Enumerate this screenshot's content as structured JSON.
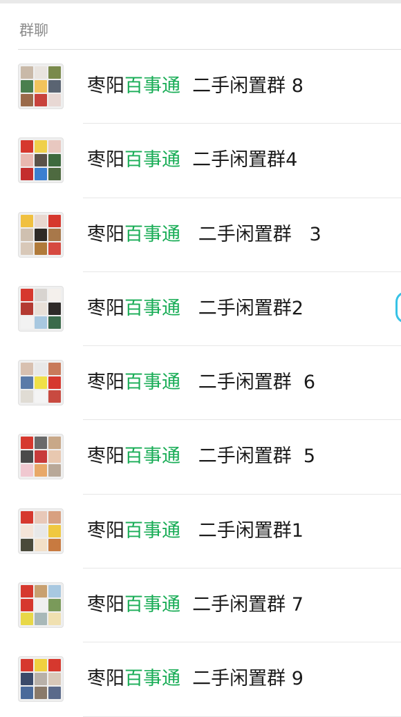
{
  "header": {
    "title": "群聊"
  },
  "palette": {
    "accent": "#1aad57",
    "text": "#1a1a1a",
    "header_text": "#8c8c8c",
    "float_button": "#36c2e6"
  },
  "groups": [
    {
      "prefix": "枣阳",
      "highlight": "百事通",
      "suffix": "  二手闲置群 8",
      "avatar_tiles": [
        "#c9b9a8",
        "#e9e4df",
        "#7a8a4c",
        "#4a7f4e",
        "#f2c35c",
        "#5a6472",
        "#9a6a4a",
        "#c8423c",
        "#e8d8d4"
      ]
    },
    {
      "prefix": "枣阳",
      "highlight": "百事通",
      "suffix": "  二手闲置群4",
      "avatar_tiles": [
        "#d6382e",
        "#f0d04a",
        "#e8c8c0",
        "#e9b8b0",
        "#5a5248",
        "#3e6a3e",
        "#c42e2e",
        "#3b7fd0",
        "#4e6a40"
      ]
    },
    {
      "prefix": "枣阳",
      "highlight": "百事通",
      "suffix": "   二手闲置群   3",
      "avatar_tiles": [
        "#f0c040",
        "#e8d8d0",
        "#d6382e",
        "#cfc0b0",
        "#2e2a26",
        "#a8784a",
        "#d8c8b8",
        "#b07a3a",
        "#d64a40"
      ]
    },
    {
      "prefix": "枣阳",
      "highlight": "百事通",
      "suffix": "   二手闲置群2",
      "avatar_tiles": [
        "#d6382e",
        "#d8d4d0",
        "#f4f0ec",
        "#b43a32",
        "#e8e0d8",
        "#2e2a28",
        "#f2f2f2",
        "#a8c8e0",
        "#3a6a4a"
      ]
    },
    {
      "prefix": "枣阳",
      "highlight": "百事通",
      "suffix": "   二手闲置群  6",
      "avatar_tiles": [
        "#d8c0b0",
        "#e8e8e8",
        "#c87a5a",
        "#5a7aa8",
        "#f0e048",
        "#d6382e",
        "#e0dcd4",
        "#f4f4f4",
        "#c84a40"
      ]
    },
    {
      "prefix": "枣阳",
      "highlight": "百事通",
      "suffix": "   二手闲置群  5",
      "avatar_tiles": [
        "#d6382e",
        "#6a6a6a",
        "#c8a888",
        "#4a4a4a",
        "#c83a3a",
        "#e8c8b0",
        "#f0c8d0",
        "#e8a868",
        "#b8a898"
      ]
    },
    {
      "prefix": "枣阳",
      "highlight": "百事通",
      "suffix": "   二手闲置群1",
      "avatar_tiles": [
        "#d6382e",
        "#e8c8b8",
        "#d8a080",
        "#f4e4d8",
        "#e8e8e8",
        "#f0c840",
        "#4a4a3a",
        "#f2e0c8",
        "#c87a40"
      ]
    },
    {
      "prefix": "枣阳",
      "highlight": "百事通",
      "suffix": "  二手闲置群 7",
      "avatar_tiles": [
        "#d6382e",
        "#c8a070",
        "#a8c8e0",
        "#d6382e",
        "#f0f0f0",
        "#7a9a5a",
        "#e8d848",
        "#a8b8b8",
        "#f0e0b0"
      ]
    },
    {
      "prefix": "枣阳",
      "highlight": "百事通",
      "suffix": "  二手闲置群 9",
      "avatar_tiles": [
        "#d6382e",
        "#f0d040",
        "#d6382e",
        "#3a4a6a",
        "#b8b0a8",
        "#d8c8b8",
        "#4a6a9a",
        "#8a7a6a",
        "#5a6a8a"
      ]
    }
  ]
}
